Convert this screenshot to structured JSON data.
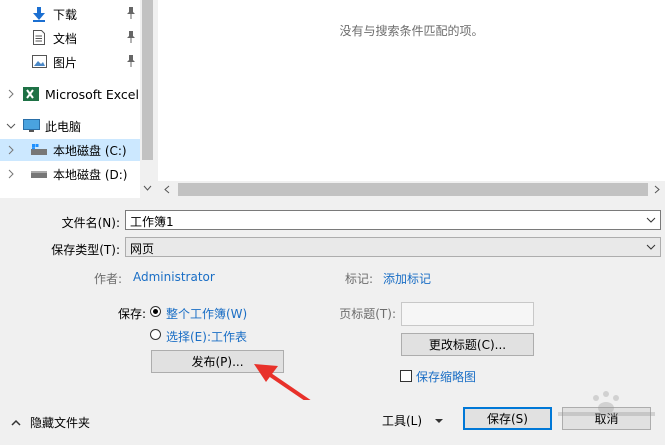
{
  "nav": {
    "items": [
      {
        "label": "下载",
        "icon": "download-arrow-icon"
      },
      {
        "label": "文档",
        "icon": "document-icon"
      },
      {
        "label": "图片",
        "icon": "pictures-icon"
      },
      {
        "label": "Microsoft Excel",
        "icon": "excel-icon"
      },
      {
        "label": "此电脑",
        "icon": "computer-icon"
      },
      {
        "label": "本地磁盘 (C:)",
        "icon": "drive-c-icon"
      },
      {
        "label": "本地磁盘 (D:)",
        "icon": "drive-d-icon"
      }
    ]
  },
  "filelist": {
    "empty_message": "没有与搜索条件匹配的项。"
  },
  "form": {
    "filename_label": "文件名(N):",
    "filename_value": "工作簿1",
    "filetype_label": "保存类型(T):",
    "filetype_value": "网页",
    "author_label": "作者:",
    "author_value": "Administrator",
    "tags_label": "标记:",
    "tags_value": "添加标记",
    "save_label": "保存:",
    "option_entire": "整个工作簿(W)",
    "option_selection": "选择(E):工作表",
    "publish_button": "发布(P)...",
    "page_title_label": "页标题(T):",
    "change_title_button": "更改标题(C)...",
    "save_thumbnail": "保存缩略图"
  },
  "footer": {
    "hide_folders": "隐藏文件夹",
    "tools": "工具(L)",
    "save": "保存(S)",
    "cancel": "取消"
  },
  "colors": {
    "accent": "#0078d7",
    "link": "#1a6ec5",
    "annotation_arrow": "#e8312a"
  }
}
